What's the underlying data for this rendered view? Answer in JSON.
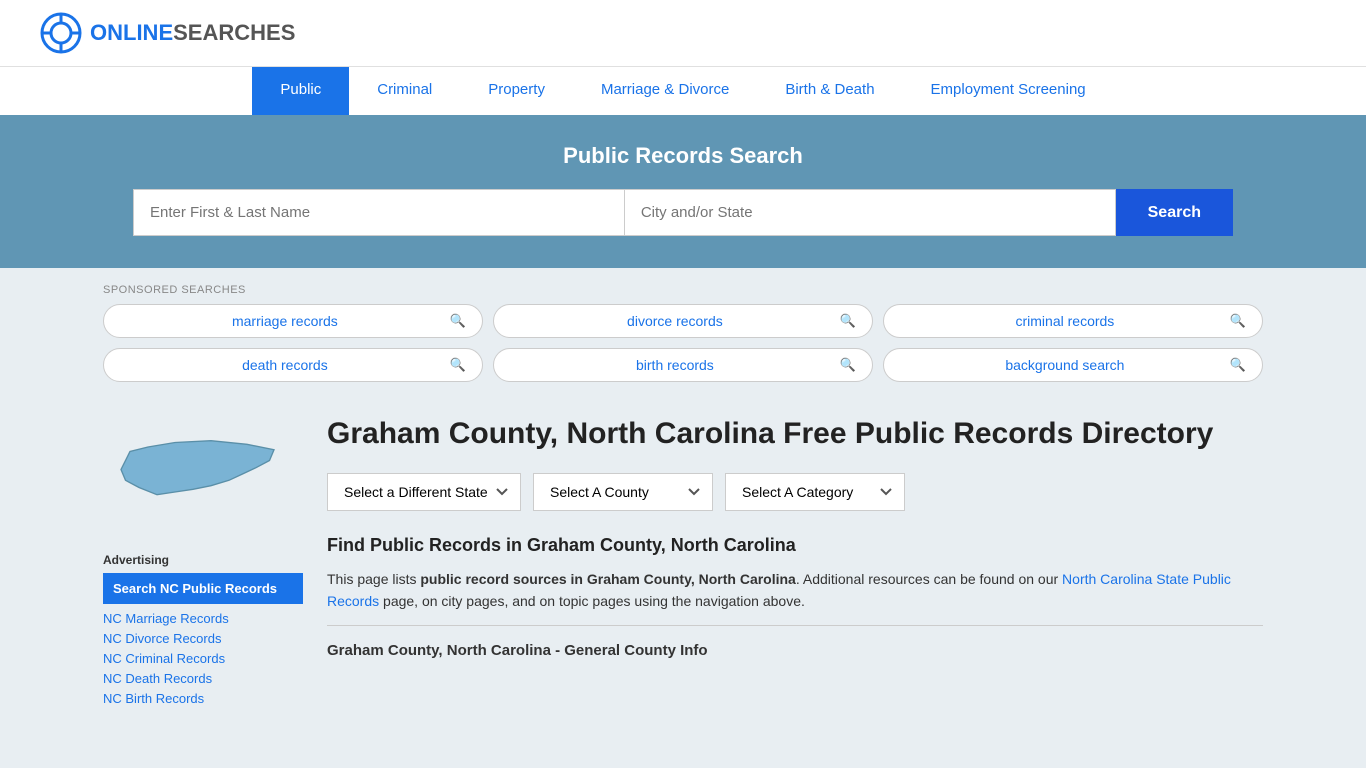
{
  "site": {
    "logo_online": "ONLINE",
    "logo_searches": "SEARCHES",
    "title": "OnlineSearches"
  },
  "nav": {
    "items": [
      {
        "label": "Public",
        "active": true
      },
      {
        "label": "Criminal",
        "active": false
      },
      {
        "label": "Property",
        "active": false
      },
      {
        "label": "Marriage & Divorce",
        "active": false
      },
      {
        "label": "Birth & Death",
        "active": false
      },
      {
        "label": "Employment Screening",
        "active": false
      }
    ]
  },
  "hero": {
    "title": "Public Records Search",
    "name_placeholder": "Enter First & Last Name",
    "location_placeholder": "City and/or State",
    "search_btn": "Search"
  },
  "sponsored": {
    "label": "SPONSORED SEARCHES",
    "pills": [
      {
        "text": "marriage records"
      },
      {
        "text": "divorce records"
      },
      {
        "text": "criminal records"
      },
      {
        "text": "death records"
      },
      {
        "text": "birth records"
      },
      {
        "text": "background search"
      }
    ]
  },
  "sidebar": {
    "ad_label": "Advertising",
    "ad_btn": "Search NC Public Records",
    "links": [
      {
        "text": "NC Marriage Records"
      },
      {
        "text": "NC Divorce Records"
      },
      {
        "text": "NC Criminal Records"
      },
      {
        "text": "NC Death Records"
      },
      {
        "text": "NC Birth Records"
      }
    ]
  },
  "main": {
    "heading": "Graham County, North Carolina Free Public Records Directory",
    "dropdowns": {
      "state": "Select a Different State",
      "county": "Select A County",
      "category": "Select A Category"
    },
    "find_heading": "Find Public Records in Graham County, North Carolina",
    "find_text_1": "This page lists ",
    "find_text_bold": "public record sources in Graham County, North Carolina",
    "find_text_2": ". Additional resources can be found on our ",
    "find_link": "North Carolina State Public Records",
    "find_text_3": " page, on city pages, and on topic pages using the navigation above.",
    "general_info": "Graham County, North Carolina - General County Info"
  }
}
